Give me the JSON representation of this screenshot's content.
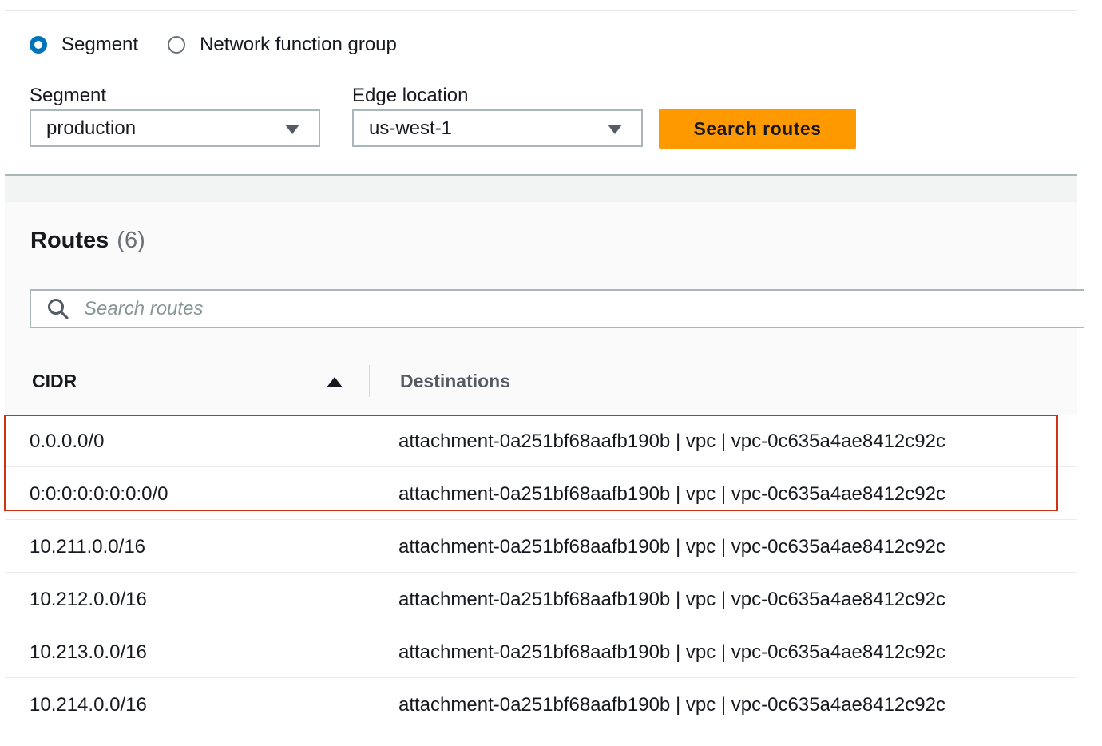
{
  "route_type": {
    "options": [
      {
        "label": "Segment",
        "selected": true
      },
      {
        "label": "Network function group",
        "selected": false
      }
    ]
  },
  "filters": {
    "segment_label": "Segment",
    "segment_value": "production",
    "edge_label": "Edge location",
    "edge_value": "us-west-1",
    "search_button": "Search routes"
  },
  "routes": {
    "title": "Routes",
    "count": "(6)",
    "search_placeholder": "Search routes",
    "columns": {
      "cidr": "CIDR",
      "destinations": "Destinations"
    },
    "sort": "ascending",
    "rows": [
      {
        "cidr": "0.0.0.0/0",
        "destination": "attachment-0a251bf68aafb190b | vpc | vpc-0c635a4ae8412c92c"
      },
      {
        "cidr": "0:0:0:0:0:0:0:0/0",
        "destination": "attachment-0a251bf68aafb190b | vpc | vpc-0c635a4ae8412c92c"
      },
      {
        "cidr": "10.211.0.0/16",
        "destination": "attachment-0a251bf68aafb190b | vpc | vpc-0c635a4ae8412c92c"
      },
      {
        "cidr": "10.212.0.0/16",
        "destination": "attachment-0a251bf68aafb190b | vpc | vpc-0c635a4ae8412c92c"
      },
      {
        "cidr": "10.213.0.0/16",
        "destination": "attachment-0a251bf68aafb190b | vpc | vpc-0c635a4ae8412c92c"
      },
      {
        "cidr": "10.214.0.0/16",
        "destination": "attachment-0a251bf68aafb190b | vpc | vpc-0c635a4ae8412c92c"
      }
    ]
  },
  "colors": {
    "primary_button": "#ff9900",
    "radio_selected": "#0073bb",
    "highlight_border": "#d13212"
  },
  "icons": {
    "search": "search-icon",
    "sort": "sort-ascending-icon",
    "dropdown": "caret-down-icon"
  }
}
